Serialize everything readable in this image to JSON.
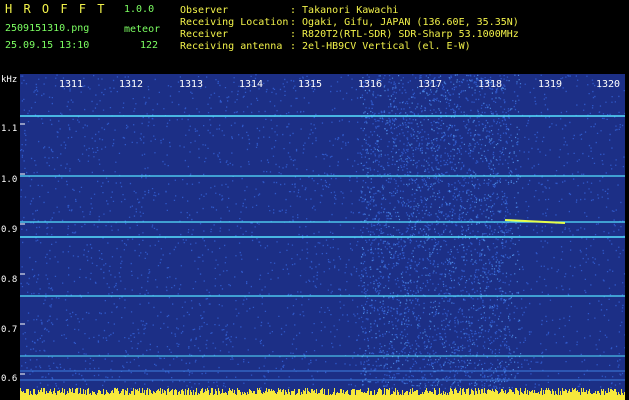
{
  "header": {
    "title": "H R O F F T",
    "version": "1.0.0",
    "filename": "2509151310.png",
    "mode": "meteor",
    "datetime": "25.09.15 13:10",
    "count": "122",
    "fields": [
      {
        "label": "Observer",
        "value": ": Takanori Kawachi"
      },
      {
        "label": "Receiving Location",
        "value": ": Ogaki, Gifu, JAPAN (136.60E, 35.35N)"
      },
      {
        "label": "Receiver",
        "value": ": R820T2(RTL-SDR) SDR-Sharp 53.1000MHz"
      },
      {
        "label": "Receiving antenna",
        "value": ": 2el-HB9CV Vertical (el. E-W)"
      }
    ]
  },
  "axes": {
    "y_unit": "kHz",
    "y_ticks": [
      "1.1",
      "1.0",
      "0.9",
      "0.8",
      "0.7",
      "0.6"
    ],
    "x_ticks": [
      "1311",
      "1312",
      "1313",
      "1314",
      "1315",
      "1316",
      "1317",
      "1318",
      "1319",
      "1320"
    ]
  },
  "colors": {
    "background": "#1c2f86",
    "noise": "#2f58c8",
    "line": "#56e2ff",
    "signal": "#e6ff4a",
    "yellow_text": "#f2f24a",
    "green_text": "#7cff62"
  }
}
